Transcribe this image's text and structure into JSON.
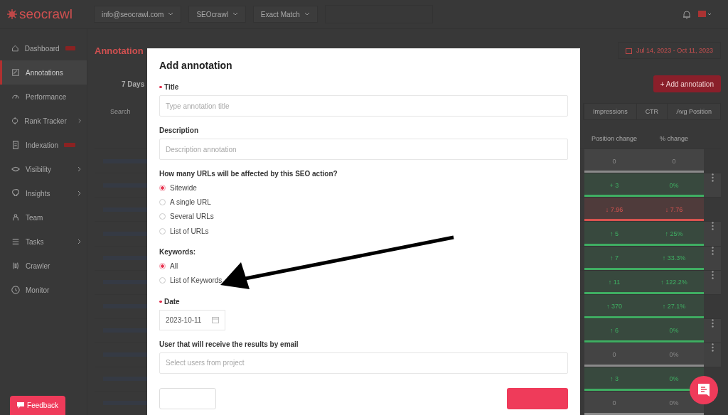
{
  "topbar": {
    "logo": "seocrawl",
    "selectors": [
      "info@seocrawl.com",
      "SEOcrawl",
      "Exact Match"
    ]
  },
  "sidebar": {
    "items": [
      {
        "label": "Dashboard",
        "badge": true,
        "expandable": false,
        "selected": false
      },
      {
        "label": "Annotations",
        "badge": false,
        "expandable": false,
        "selected": true
      },
      {
        "label": "Performance",
        "badge": false,
        "expandable": false,
        "selected": false
      },
      {
        "label": "Rank Tracker",
        "badge": false,
        "expandable": true,
        "selected": false
      },
      {
        "label": "Indexation",
        "badge": true,
        "expandable": false,
        "selected": false
      },
      {
        "label": "Visibility",
        "badge": false,
        "expandable": true,
        "selected": false
      },
      {
        "label": "Insights",
        "badge": false,
        "expandable": true,
        "selected": false
      },
      {
        "label": "Team",
        "badge": false,
        "expandable": false,
        "selected": false
      },
      {
        "label": "Tasks",
        "badge": false,
        "expandable": true,
        "selected": false
      },
      {
        "label": "Crawler",
        "badge": false,
        "expandable": false,
        "selected": false
      },
      {
        "label": "Monitor",
        "badge": false,
        "expandable": false,
        "selected": false
      }
    ],
    "feedback": "Feedback"
  },
  "main": {
    "title": "Annotation",
    "date_range": "Jul 14, 2023 - Oct 11, 2023",
    "period": "7 Days",
    "add_button": "+ Add annotation",
    "search_placeholder": "Search",
    "metric_tabs": [
      "Impressions",
      "CTR",
      "Avg Position"
    ],
    "columns": [
      "Position change",
      "% change"
    ],
    "rows": [
      {
        "change": "0",
        "percent": "0",
        "color": "#8a8a8a",
        "menu": false
      },
      {
        "change": "+ 3",
        "percent": "0%",
        "color": "#3fae62",
        "menu": true
      },
      {
        "change": "↓ 7.96",
        "percent": "↓ 7.76",
        "color": "#d9534f",
        "menu": false
      },
      {
        "change": "↑ 5",
        "percent": "↑ 25%",
        "color": "#3fae62",
        "menu": true
      },
      {
        "change": "↑ 7",
        "percent": "↑ 33.3%",
        "color": "#3fae62",
        "menu": true
      },
      {
        "change": "↑ 11",
        "percent": "↑ 122.2%",
        "color": "#3fae62",
        "menu": true
      },
      {
        "change": "↑ 370",
        "percent": "↑ 27.1%",
        "color": "#3fae62",
        "menu": false
      },
      {
        "change": "↑ 6",
        "percent": "0%",
        "color": "#3fae62",
        "menu": true
      },
      {
        "change": "0",
        "percent": "0%",
        "color": "#8a8a8a",
        "menu": true
      },
      {
        "change": "↑ 3",
        "percent": "0%",
        "color": "#3fae62",
        "menu": false
      },
      {
        "change": "0",
        "percent": "0%",
        "color": "#8a8a8a"
      }
    ]
  },
  "modal": {
    "title": "Add annotation",
    "fields": [
      {
        "kind": "text",
        "label": "Title",
        "required": true,
        "placeholder": "Type annotation title"
      },
      {
        "kind": "text",
        "label": "Description",
        "required": false,
        "placeholder": "Description annotation"
      },
      {
        "kind": "radio",
        "label": "How many URLs will be affected by this SEO action?",
        "required": false,
        "options": [
          {
            "label": "Sitewide",
            "selected": true
          },
          {
            "label": "A single URL",
            "selected": false
          },
          {
            "label": "Several URLs",
            "selected": false
          },
          {
            "label": "List of URLs",
            "selected": false
          }
        ]
      },
      {
        "kind": "radio",
        "label": "Keywords:",
        "required": false,
        "options": [
          {
            "label": "All",
            "selected": true
          },
          {
            "label": "List of Keywords",
            "selected": false
          }
        ]
      },
      {
        "kind": "date",
        "label": "Date",
        "required": true,
        "value": "2023-10-11"
      },
      {
        "kind": "select",
        "label": "User that will receive the results by email",
        "required": false,
        "placeholder": "Select users from project"
      }
    ]
  }
}
